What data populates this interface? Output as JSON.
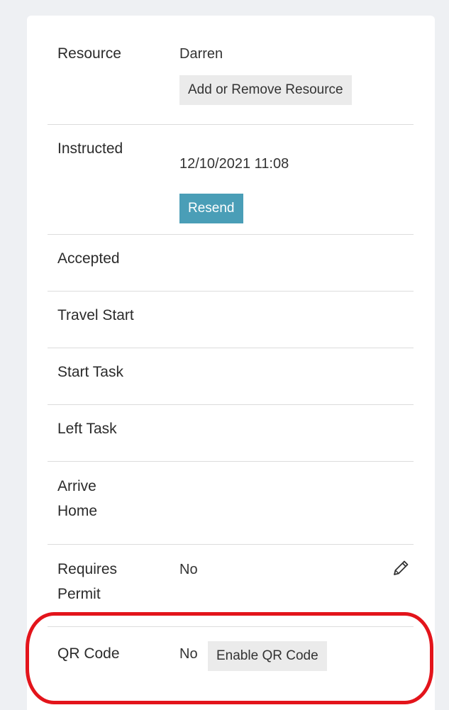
{
  "rows": {
    "resource": {
      "label": "Resource",
      "value": "Darren",
      "button_label": "Add or Remove Resource"
    },
    "instructed": {
      "label": "Instructed",
      "value": "12/10/2021 11:08",
      "button_label": "Resend"
    },
    "accepted": {
      "label": "Accepted"
    },
    "travel_start": {
      "label": "Travel Start"
    },
    "start_task": {
      "label": "Start Task"
    },
    "left_task": {
      "label": "Left Task"
    },
    "arrive_home": {
      "label_line1": "Arrive",
      "label_line2": "Home"
    },
    "requires_permit": {
      "label_line1": "Requires",
      "label_line2": "Permit",
      "value": "No",
      "edit_icon": "pencil-icon"
    },
    "qr_code": {
      "label": "QR Code",
      "value": "No",
      "button_label": "Enable QR Code"
    }
  },
  "colors": {
    "page_background": "#eef0f3",
    "card_background": "#ffffff",
    "primary_button": "#4a9eb7",
    "secondary_button": "#ebebeb",
    "divider": "#dcdcdc",
    "highlight": "#e3141b"
  }
}
